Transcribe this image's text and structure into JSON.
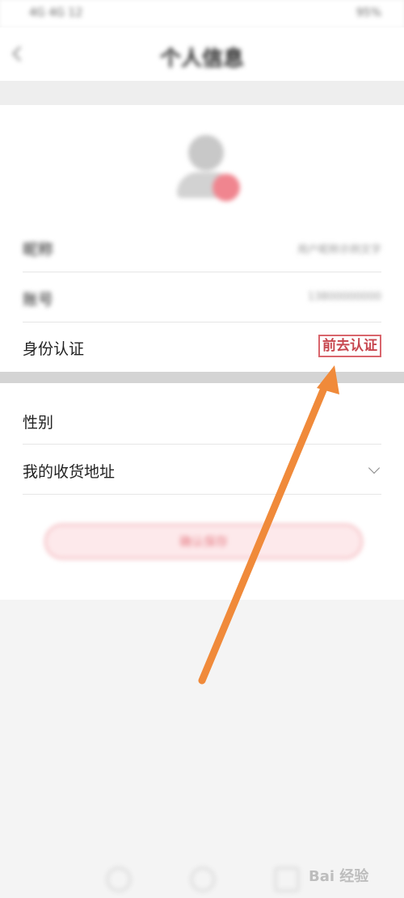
{
  "status_bar": {
    "left": "4G 4G 12",
    "right": "95%"
  },
  "header": {
    "title": "个人信息"
  },
  "profile": {
    "rows": [
      {
        "label": "昵称",
        "value": "用户昵称示例文字"
      },
      {
        "label": "账号",
        "value": "13800000000"
      },
      {
        "label": "身份认证",
        "action": "前去认证"
      }
    ]
  },
  "details": {
    "rows": [
      {
        "label": "性别"
      },
      {
        "label": "我的收货地址"
      }
    ]
  },
  "submit_label": "确认保存",
  "watermark": "Bai 经验",
  "colors": {
    "accent": "#d9656c",
    "arrow": "#f08a3a"
  }
}
